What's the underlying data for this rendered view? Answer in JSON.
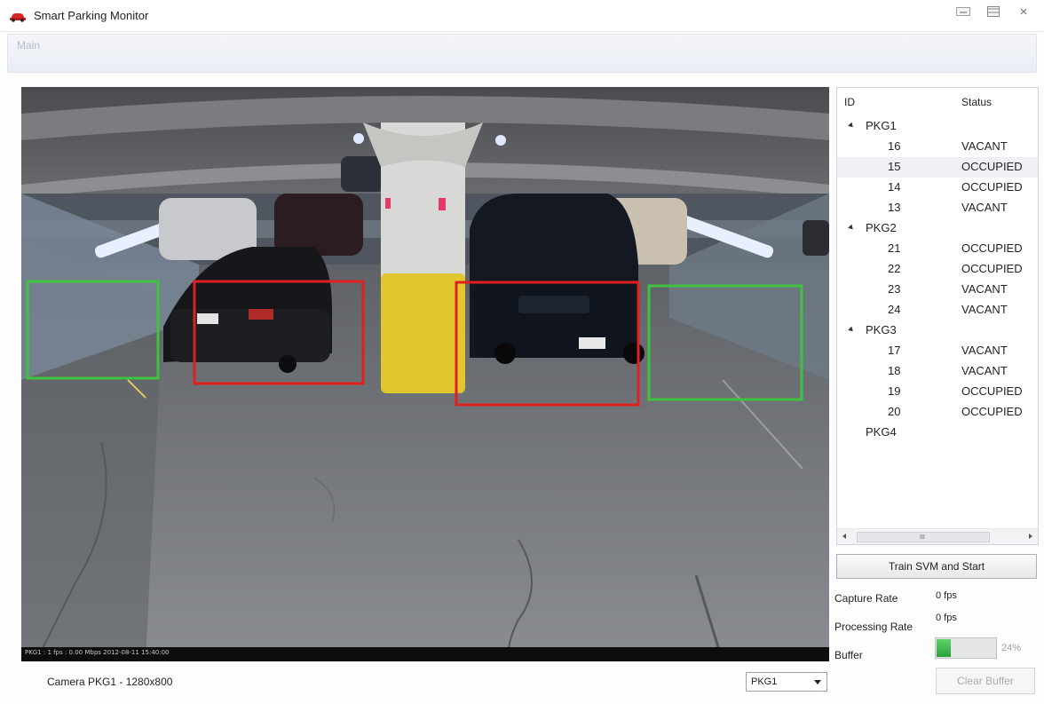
{
  "window": {
    "title": "Smart Parking Monitor",
    "icon": "red-car-icon",
    "controls": [
      "minimize-icon",
      "maximize-icon",
      "close-icon"
    ]
  },
  "menu": {
    "items": [
      {
        "label": "Main"
      }
    ]
  },
  "video": {
    "overlay_text": "PKG1 : 1 fps : 0.00 Mbps 2012-08-11 15:40:00",
    "spots": [
      {
        "status": "VACANT",
        "color": "#3fc33f"
      },
      {
        "status": "OCCUPIED",
        "color": "#e02020"
      },
      {
        "status": "OCCUPIED",
        "color": "#e02020"
      },
      {
        "status": "VACANT",
        "color": "#3fc33f"
      }
    ]
  },
  "camera_info": "Camera PKG1 - 1280x800",
  "camera_select": {
    "value": "PKG1"
  },
  "status_panel": {
    "columns": {
      "id": "ID",
      "status": "Status"
    },
    "groups": [
      {
        "name": "PKG1",
        "expanded": true,
        "spots": [
          {
            "id": "16",
            "status": "VACANT"
          },
          {
            "id": "15",
            "status": "OCCUPIED",
            "selected": true
          },
          {
            "id": "14",
            "status": "OCCUPIED"
          },
          {
            "id": "13",
            "status": "VACANT"
          }
        ]
      },
      {
        "name": "PKG2",
        "expanded": true,
        "spots": [
          {
            "id": "21",
            "status": "OCCUPIED"
          },
          {
            "id": "22",
            "status": "OCCUPIED"
          },
          {
            "id": "23",
            "status": "VACANT"
          },
          {
            "id": "24",
            "status": "VACANT"
          }
        ]
      },
      {
        "name": "PKG3",
        "expanded": true,
        "spots": [
          {
            "id": "17",
            "status": "VACANT"
          },
          {
            "id": "18",
            "status": "VACANT"
          },
          {
            "id": "19",
            "status": "OCCUPIED"
          },
          {
            "id": "20",
            "status": "OCCUPIED"
          }
        ]
      },
      {
        "name": "PKG4",
        "expanded": false,
        "spots": []
      }
    ],
    "scroll_grip": "III"
  },
  "controls": {
    "train_button": "Train SVM and Start",
    "capture_rate": {
      "label": "Capture Rate",
      "value": "0 fps"
    },
    "processing_rate": {
      "label": "Processing Rate",
      "value": "0 fps"
    },
    "buffer": {
      "label": "Buffer",
      "value": 0.24,
      "text": "24%",
      "color": "#3db847"
    },
    "clear_button": "Clear Buffer"
  }
}
